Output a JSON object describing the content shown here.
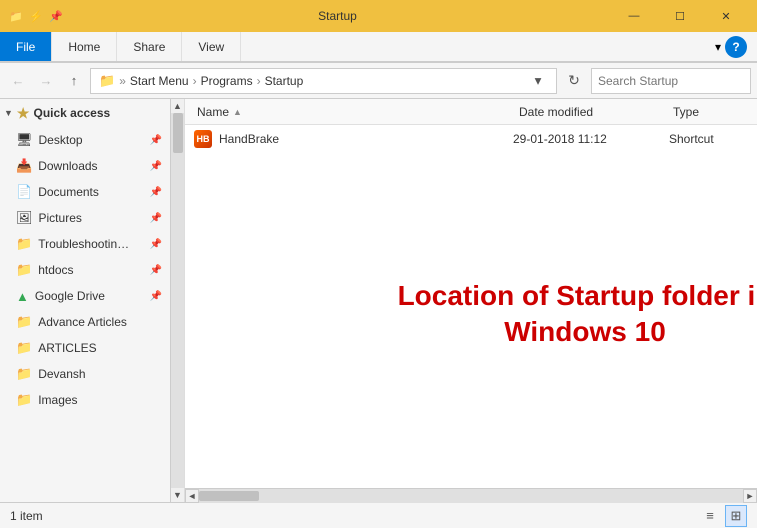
{
  "titleBar": {
    "title": "Startup",
    "minLabel": "—",
    "maxLabel": "☐",
    "closeLabel": "✕"
  },
  "ribbon": {
    "tabs": [
      "File",
      "Home",
      "Share",
      "View"
    ],
    "expandLabel": "▾",
    "helpLabel": "?"
  },
  "addressBar": {
    "backLabel": "←",
    "forwardLabel": "→",
    "upLabel": "↑",
    "refreshLabel": "⟳",
    "dropdownLabel": "▾",
    "breadcrumb": {
      "folderIcon": "📁",
      "parts": [
        "Start Menu",
        "Programs",
        "Startup"
      ]
    },
    "search": {
      "placeholder": "Search Startup",
      "icon": "🔍"
    },
    "helpLabel": "?"
  },
  "sidebar": {
    "quickAccess": {
      "label": "Quick access",
      "starIcon": "★"
    },
    "items": [
      {
        "label": "Desktop",
        "icon": "🖥",
        "pinned": true
      },
      {
        "label": "Downloads",
        "icon": "📥",
        "pinned": true
      },
      {
        "label": "Documents",
        "icon": "📄",
        "pinned": true
      },
      {
        "label": "Pictures",
        "icon": "🖼",
        "pinned": true
      },
      {
        "label": "Troubleshootin…",
        "icon": "📁",
        "pinned": true
      },
      {
        "label": "htdocs",
        "icon": "📁",
        "pinned": true
      },
      {
        "label": "Google Drive",
        "icon": "🔺",
        "pinned": true
      },
      {
        "label": "Advance Articles",
        "icon": "📁",
        "pinned": false
      },
      {
        "label": "ARTICLES",
        "icon": "📁",
        "pinned": false
      },
      {
        "label": "Devansh",
        "icon": "📁",
        "pinned": false
      },
      {
        "label": "Images",
        "icon": "📁",
        "pinned": false
      }
    ],
    "scrollUpLabel": "▲",
    "scrollDownLabel": "▼"
  },
  "fileList": {
    "columns": {
      "name": "Name",
      "dateModified": "Date modified",
      "type": "Type"
    },
    "sortArrow": "▲",
    "items": [
      {
        "name": "HandBrake",
        "dateModified": "29-01-2018 11:12",
        "type": "Shortcut"
      }
    ]
  },
  "overlay": {
    "line1": "Location of Startup folder in",
    "line2": "Windows 10"
  },
  "statusBar": {
    "itemCount": "1 item",
    "listViewLabel": "≡",
    "detailViewLabel": "⊞"
  },
  "hScrollbar": {
    "leftLabel": "◄",
    "rightLabel": "►"
  },
  "colors": {
    "accent": "#0078d7",
    "titleBarBg": "#f0c040",
    "overlayText": "#cc0000",
    "activeItem": "#cde8ff"
  }
}
